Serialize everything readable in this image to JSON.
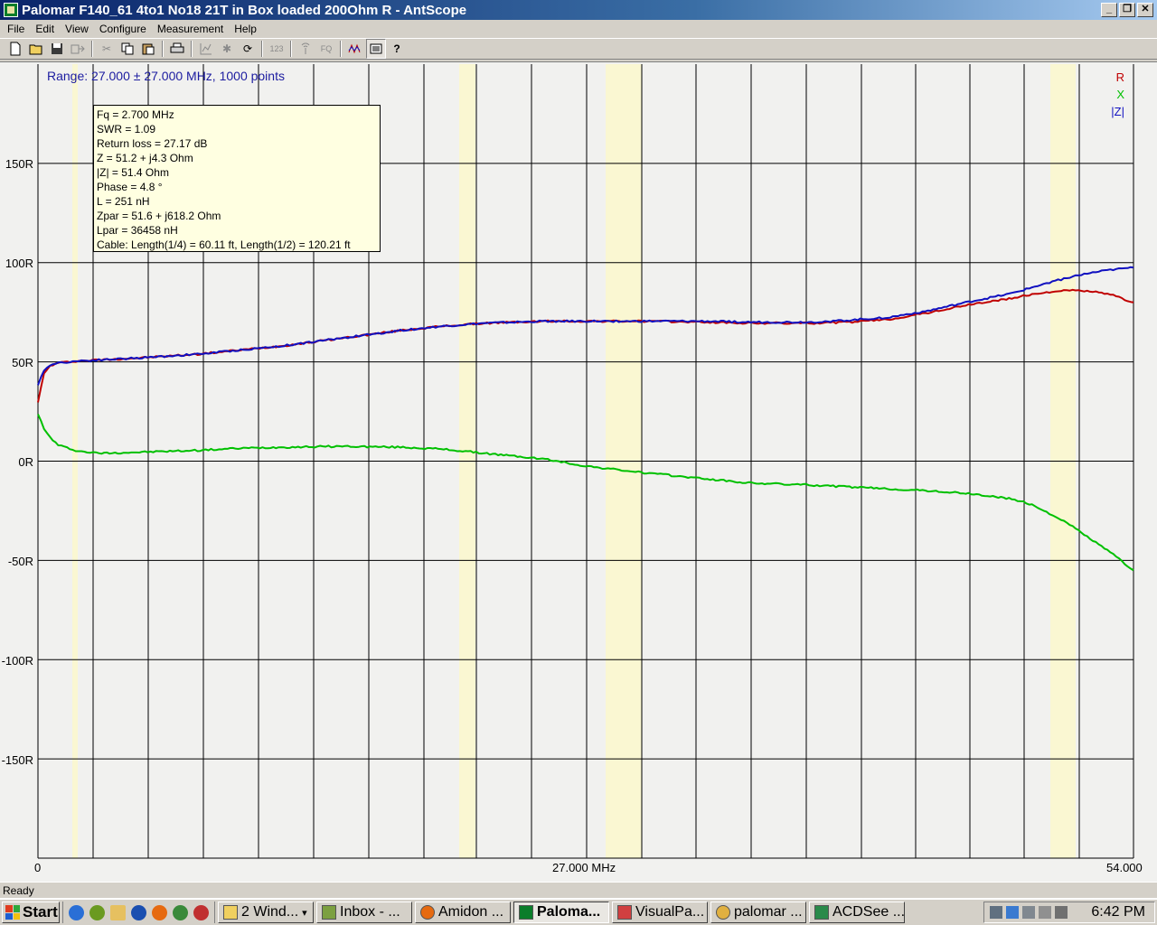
{
  "window": {
    "title": "Palomar F140_61 4to1 No18 21T in Box loaded 200Ohm R - AntScope",
    "minimize": "_",
    "maximize": "❐",
    "close": "✕"
  },
  "menu": [
    "File",
    "Edit",
    "View",
    "Configure",
    "Measurement",
    "Help"
  ],
  "toolbar": {
    "icons": [
      "new-file-icon",
      "open-folder-icon",
      "save-icon",
      "export-icon",
      "cut-icon",
      "copy-icon",
      "paste-icon",
      "print-icon",
      "chart-icon",
      "star-icon",
      "refresh-icon",
      "counter-icon",
      "antenna-icon",
      "frequency-icon",
      "waveform-icon",
      "list-icon",
      "help-icon"
    ],
    "counter_label": "123",
    "fq_label": "FQ"
  },
  "plot": {
    "range_label": "Range: 27.000 ± 27.000 MHz, 1000 points",
    "legend": [
      {
        "label": "R",
        "color": "#c00000"
      },
      {
        "label": "X",
        "color": "#00c000"
      },
      {
        "label": "|Z|",
        "color": "#1010c0"
      }
    ],
    "y_tick_labels": [
      "150R",
      "100R",
      "50R",
      "0R",
      "-50R",
      "-100R",
      "-150R"
    ],
    "x_tick_labels": [
      "0",
      "27.000 MHz",
      "54.000"
    ],
    "info": [
      "Fq = 2.700 MHz",
      "SWR = 1.09",
      "Return loss = 27.17 dB",
      "Z = 51.2 + j4.3 Ohm",
      "|Z| = 51.4 Ohm",
      "Phase = 4.8 °",
      "L = 251 nH",
      "Zpar = 51.6 + j618.2 Ohm",
      "Lpar = 36458 nH",
      "Cable: Length(1/4) = 60.11 ft, Length(1/2) = 120.21 ft"
    ],
    "grid_color": "#000000",
    "band_color": "#faf7d2",
    "background": "#f1f1ef"
  },
  "chart_data": {
    "type": "line",
    "xlim": [
      0,
      54
    ],
    "ylim": [
      -200,
      200
    ],
    "xunit": "MHz",
    "yunit": "Ohm",
    "x": [
      0,
      0.3,
      0.6,
      1,
      2,
      3,
      5,
      8,
      10,
      12,
      15,
      18,
      20,
      22,
      25,
      27,
      30,
      33,
      35,
      38,
      40,
      42,
      44,
      46,
      48,
      49,
      50,
      51,
      52,
      53,
      54
    ],
    "series": [
      {
        "name": "R",
        "values": [
          30,
          44,
          48,
          49.5,
          50.5,
          51,
          52,
          54,
          56,
          58,
          62,
          66,
          68,
          69.5,
          70.5,
          70.5,
          70.5,
          70,
          69.5,
          69.5,
          70,
          71.5,
          75,
          79,
          82,
          84,
          85.5,
          86,
          85.5,
          83.5,
          80
        ]
      },
      {
        "name": "X",
        "values": [
          24,
          16,
          12,
          8,
          5,
          4,
          4.5,
          5.5,
          6.5,
          7,
          7.5,
          7,
          6,
          4,
          1,
          -2.5,
          -6,
          -9,
          -11,
          -12,
          -13,
          -14,
          -15,
          -16.5,
          -19,
          -22,
          -27,
          -33,
          -40,
          -47,
          -55
        ]
      },
      {
        "name": "|Z|",
        "values": [
          38,
          46,
          48.5,
          49.5,
          50.5,
          51,
          52,
          54,
          56,
          58,
          62,
          66,
          68,
          69.5,
          70.5,
          70.5,
          70.5,
          70.5,
          70,
          70,
          71,
          72.5,
          76,
          80.5,
          84.5,
          87.5,
          90.5,
          93,
          95,
          96.5,
          97.5
        ]
      }
    ]
  },
  "status": {
    "text": "Ready"
  },
  "taskbar": {
    "start": "Start",
    "quicklaunch": [
      "ie-icon",
      "hydra-icon",
      "explorer-icon",
      "media-player-icon",
      "firefox-icon",
      "browser-icon",
      "cd-icon"
    ],
    "tasks": [
      {
        "label": "2 Wind...",
        "icon": "folder-icon",
        "active": false,
        "arrow": "▾"
      },
      {
        "label": "Inbox - ...",
        "icon": "mail-icon",
        "active": false
      },
      {
        "label": "Amidon ...",
        "icon": "firefox-icon",
        "active": false
      },
      {
        "label": "Paloma...",
        "icon": "antscope-icon",
        "active": true
      },
      {
        "label": "VisualPa...",
        "icon": "visualpa-icon",
        "active": false
      },
      {
        "label": "palomar ...",
        "icon": "search-icon",
        "active": false
      },
      {
        "label": "ACDSee ...",
        "icon": "acdsee-icon",
        "active": false
      }
    ],
    "clock": "6:42 PM"
  }
}
